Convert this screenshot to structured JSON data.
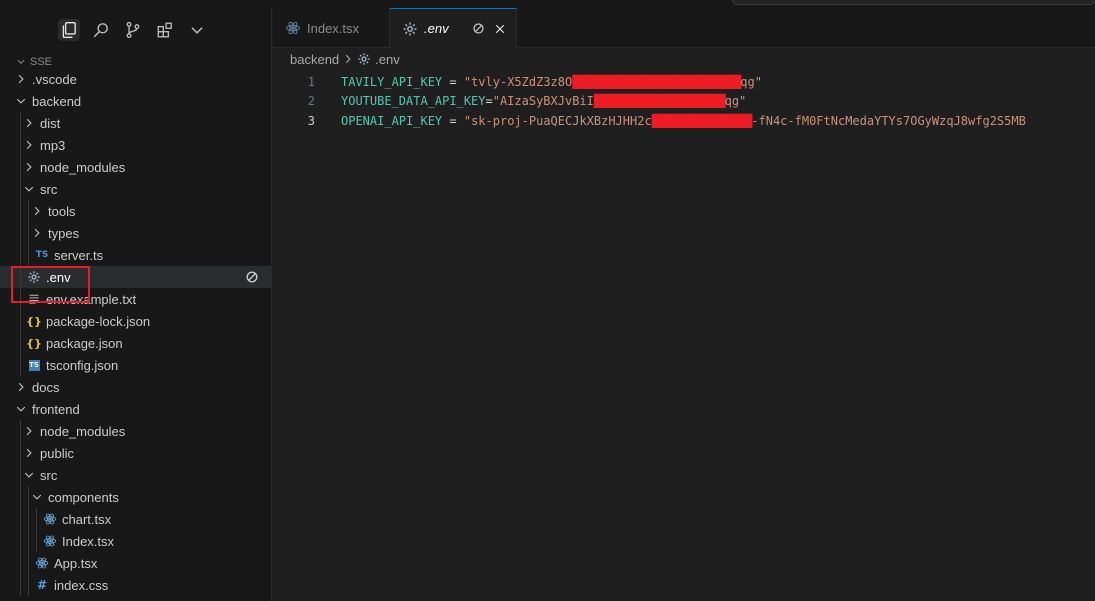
{
  "sidebar": {
    "section_title": "SSE",
    "tree": [
      {
        "label": ".vscode",
        "type": "folder",
        "depth": 0,
        "open": false
      },
      {
        "label": "backend",
        "type": "folder",
        "depth": 0,
        "open": true
      },
      {
        "label": "dist",
        "type": "folder",
        "depth": 1,
        "open": false
      },
      {
        "label": "mp3",
        "type": "folder",
        "depth": 1,
        "open": false
      },
      {
        "label": "node_modules",
        "type": "folder",
        "depth": 1,
        "open": false
      },
      {
        "label": "src",
        "type": "folder",
        "depth": 1,
        "open": true
      },
      {
        "label": "tools",
        "type": "folder",
        "depth": 2,
        "open": false
      },
      {
        "label": "types",
        "type": "folder",
        "depth": 2,
        "open": false
      },
      {
        "label": "server.ts",
        "type": "ts",
        "depth": 2
      },
      {
        "label": ".env",
        "type": "gear",
        "depth": 1,
        "selected": true
      },
      {
        "label": "env.example.txt",
        "type": "text",
        "depth": 1
      },
      {
        "label": "package-lock.json",
        "type": "json",
        "depth": 1
      },
      {
        "label": "package.json",
        "type": "json",
        "depth": 1
      },
      {
        "label": "tsconfig.json",
        "type": "tsconfig",
        "depth": 1
      },
      {
        "label": "docs",
        "type": "folder",
        "depth": 0,
        "open": false
      },
      {
        "label": "frontend",
        "type": "folder",
        "depth": 0,
        "open": true
      },
      {
        "label": "node_modules",
        "type": "folder",
        "depth": 1,
        "open": false
      },
      {
        "label": "public",
        "type": "folder",
        "depth": 1,
        "open": false
      },
      {
        "label": "src",
        "type": "folder",
        "depth": 1,
        "open": true
      },
      {
        "label": "components",
        "type": "folder",
        "depth": 2,
        "open": true
      },
      {
        "label": "chart.tsx",
        "type": "react",
        "depth": 3
      },
      {
        "label": "Index.tsx",
        "type": "react",
        "depth": 3
      },
      {
        "label": "App.tsx",
        "type": "react",
        "depth": 2
      },
      {
        "label": "index.css",
        "type": "css",
        "depth": 2
      }
    ]
  },
  "tabs": [
    {
      "label": "Index.tsx",
      "active": false
    },
    {
      "label": ".env",
      "active": true
    }
  ],
  "breadcrumb": {
    "folder": "backend",
    "file": ".env"
  },
  "code": {
    "lines": [
      {
        "number": "1",
        "key": "TAVILY_API_KEY",
        "eq": " = ",
        "value": "\"tvly-X5ZdZ3z8O███████████████████████████qg\""
      },
      {
        "number": "2",
        "key": "YOUTUBE_DATA_API_KEY",
        "eq": "=",
        "value": "\"AIzaSyBXJvBiI█████████████████████qg\""
      },
      {
        "number": "3",
        "key": "OPENAI_API_KEY",
        "eq": " = ",
        "value": "\"sk-proj-PuaQECJkXBzHJHH2c████████████████-fN4c-fM0FtNcMedaYTYs7OGyWzqJ8wfg2S5MB",
        "current": true
      }
    ]
  },
  "colors": {
    "accent": "#0078d4",
    "highlight_box": "#e51c2b",
    "redaction": "#ee1c24"
  }
}
